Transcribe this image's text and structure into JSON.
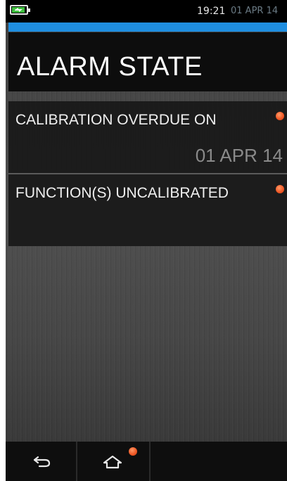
{
  "status_bar": {
    "time": "19:21",
    "date": "01 APR 14",
    "battery_icon": "battery-charging-icon"
  },
  "screen": {
    "title": "ALARM STATE"
  },
  "alarms": [
    {
      "label": "CALIBRATION OVERDUE ON",
      "value": "01 APR 14",
      "indicator_color": "#f05a28"
    },
    {
      "label": "FUNCTION(S) UNCALIBRATED",
      "indicator_color": "#f05a28"
    }
  ],
  "nav": {
    "back_icon": "back-arrow-icon",
    "home_icon": "home-icon",
    "home_notification_color": "#f05a28"
  },
  "colors": {
    "accent": "#1f8ee0",
    "alarm": "#f05a28"
  }
}
